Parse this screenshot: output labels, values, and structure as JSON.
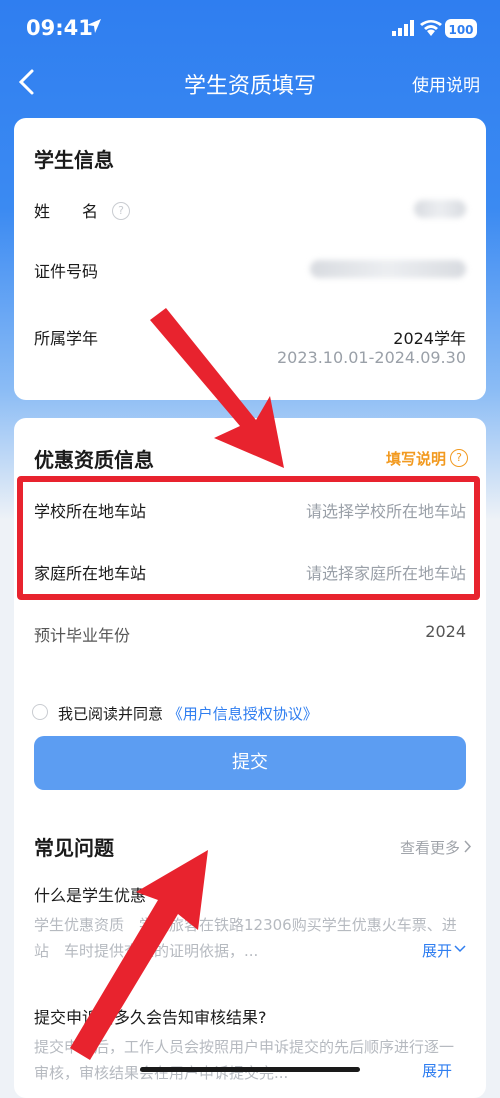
{
  "status_bar": {
    "time": "09:41",
    "battery": "100"
  },
  "nav": {
    "title": "学生资质填写",
    "help": "使用说明"
  },
  "student_info": {
    "title": "学生信息",
    "name_label": "姓　　名",
    "id_label": "证件号码",
    "year_label": "所属学年",
    "year_value": "2024学年",
    "year_range": "2023.10.01-2024.09.30"
  },
  "discount_info": {
    "title": "优惠资质信息",
    "help": "填写说明",
    "school_label": "学校所在地车站",
    "school_placeholder": "请选择学校所在地车站",
    "home_label": "家庭所在地车站",
    "home_placeholder": "请选择家庭所在地车站",
    "grad_label": "预计毕业年份",
    "grad_value": "2024"
  },
  "agreement": {
    "text": "我已阅读并同意",
    "link": "《用户信息授权协议》"
  },
  "submit_label": "提交",
  "faq": {
    "title": "常见问题",
    "more": "查看更多",
    "items": [
      {
        "q": "什么是学生优惠",
        "a": "学生优惠资质　学生旅客在铁路12306购买学生优惠火车票、进站　车时提供查验的证明依据，...",
        "expand": "展开"
      },
      {
        "q": "提交申诉后多久会告知审核结果?",
        "a": "提交申诉后，工作人员会按照用户申诉提交的先后顺序进行逐一审核，审核结果会在用户申诉提交完...",
        "expand": "展开"
      }
    ]
  },
  "colors": {
    "primary": "#2f7ef0",
    "accent": "#f29a20",
    "highlight": "#e8232e"
  }
}
